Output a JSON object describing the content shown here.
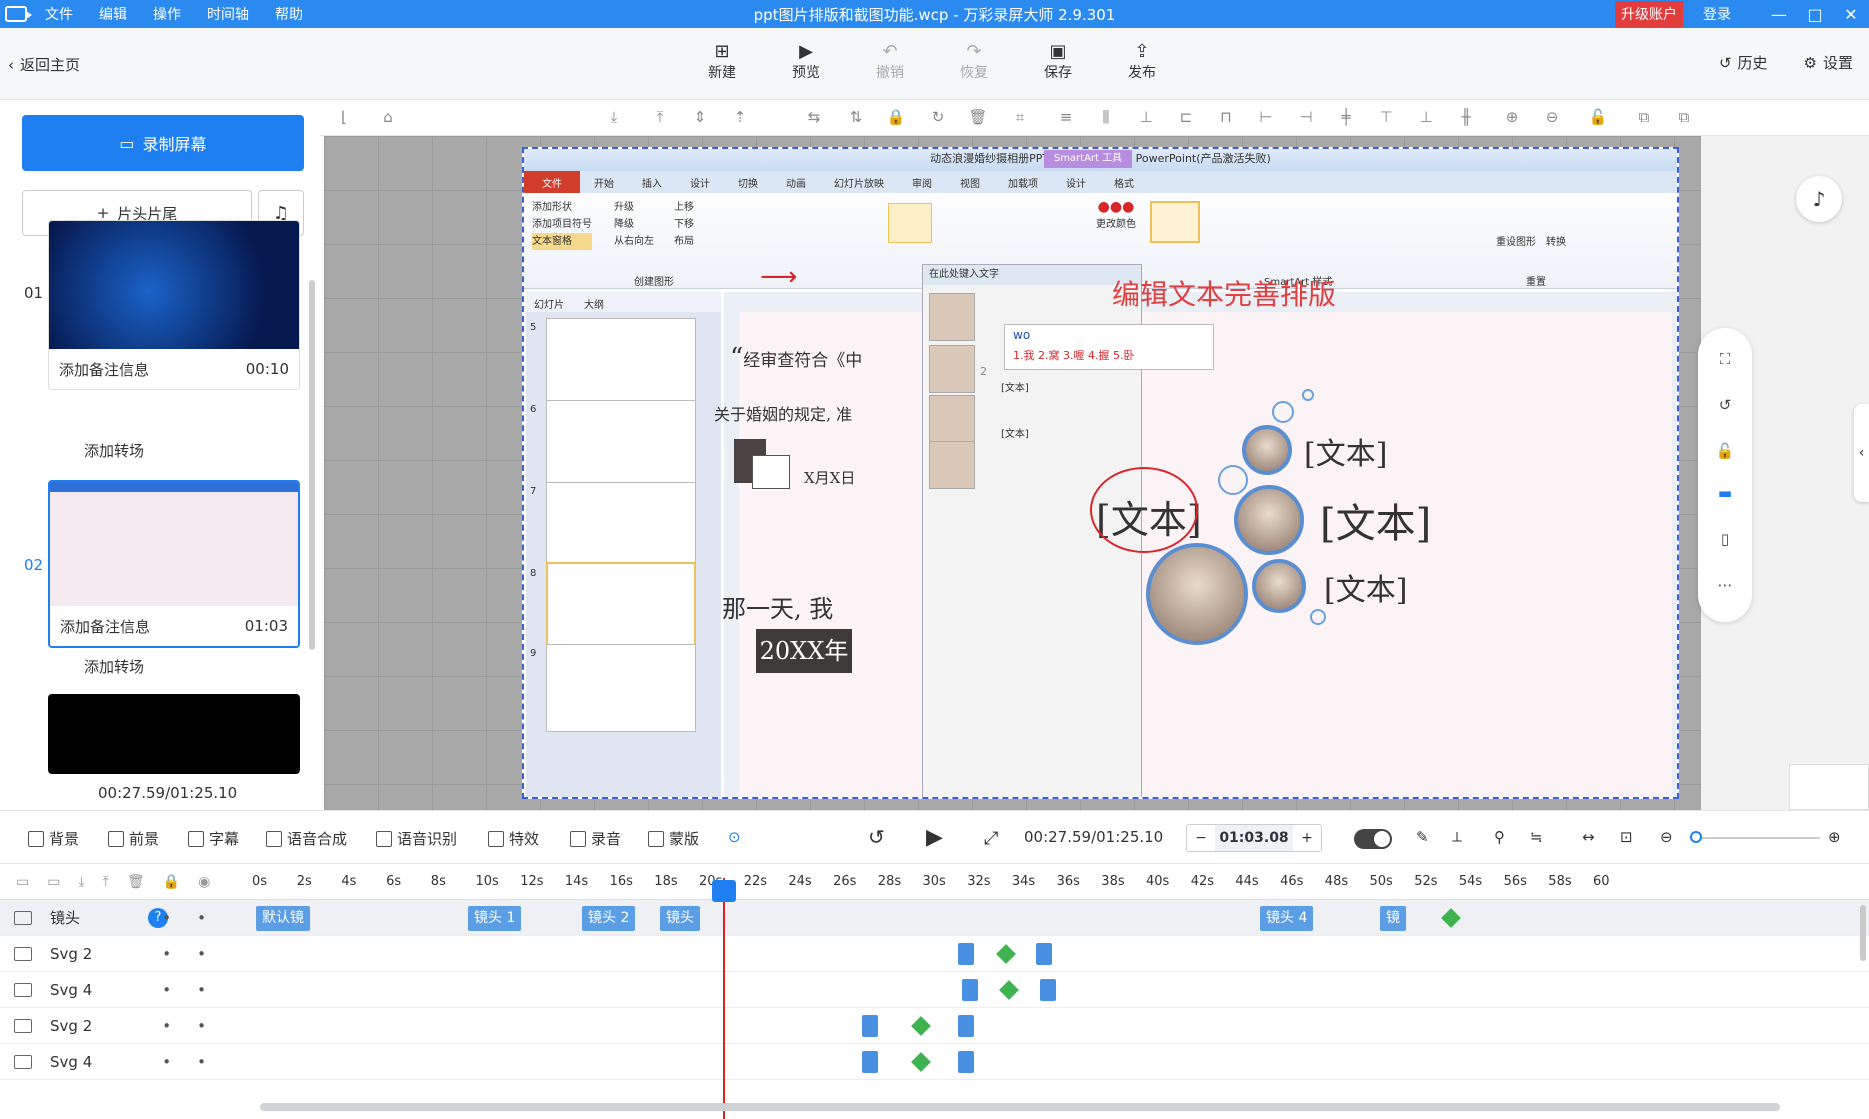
{
  "app": {
    "title": "ppt图片排版和截图功能.wcp - 万彩录屏大师 2.9.301",
    "menu": [
      "文件",
      "编辑",
      "操作",
      "时间轴",
      "帮助"
    ],
    "upgrade": "升级账户",
    "login": "登录",
    "win": [
      "—",
      "□",
      "✕"
    ]
  },
  "toolbar": {
    "back": "返回主页",
    "tools": [
      {
        "label": "新建",
        "icon": "new-icon"
      },
      {
        "label": "预览",
        "icon": "play-icon"
      },
      {
        "label": "撤销",
        "icon": "undo-icon"
      },
      {
        "label": "恢复",
        "icon": "redo-icon"
      },
      {
        "label": "保存",
        "icon": "save-icon"
      },
      {
        "label": "发布",
        "icon": "publish-icon"
      }
    ],
    "history": "历史",
    "settings": "设置"
  },
  "left": {
    "record": "录制屏幕",
    "headtail": "片头片尾",
    "clips": [
      {
        "num": "01",
        "note": "添加备注信息",
        "duration": "00:10"
      },
      {
        "num": "02",
        "note": "添加备注信息",
        "duration": "01:03"
      }
    ],
    "transition": "添加转场",
    "time": "00:27.59/01:25.10"
  },
  "ppt": {
    "window_title": "动态浪漫婚纱摄相册PPT模板 - Microsoft PowerPoint(产品激活失败)",
    "smartart_tools": "SmartArt 工具",
    "tabs": [
      "文件",
      "开始",
      "插入",
      "设计",
      "切换",
      "动画",
      "幻灯片放映",
      "审阅",
      "视图",
      "加载项",
      "设计",
      "格式"
    ],
    "ribbon_left": [
      "添加形状",
      "添加项目符号",
      "文本窗格",
      "升级",
      "降级",
      "从右向左",
      "上移",
      "下移",
      "布局"
    ],
    "group_create": "创建图形",
    "group_style": "SmartArt 样式",
    "group_reset": "重置",
    "change_color": "更改颜色",
    "reset_graphic": "重设图形",
    "convert": "转换",
    "pane_tabs": [
      "幻灯片",
      "大纲"
    ],
    "slide_nums": [
      "5",
      "6",
      "7",
      "8",
      "9"
    ],
    "textpane_title": "在此处键入文字",
    "bullets": [
      "[文本]",
      "[文本]"
    ],
    "ime_input": "wo",
    "ime_candidates": "1.我 2.窝 3.喔 4.握 5.卧",
    "annotation": "编辑文本完善排版",
    "quote": "经审查符合《中",
    "line2": "关于婚姻的规定, 准",
    "date": "X月X日",
    "line3": "那一天, 我",
    "year": "20XX年",
    "text_left": "[文本]",
    "text_r1": "[文本]",
    "text_r2": "[文本]",
    "text_r3": "[文本]",
    "badge": "2"
  },
  "bottom": {
    "items": [
      "背景",
      "前景",
      "字幕",
      "语音合成",
      "语音识别",
      "特效",
      "录音",
      "蒙版"
    ],
    "timecode": "00:27.59/01:25.10",
    "duration": "01:03.08",
    "minus": "−",
    "plus": "+"
  },
  "timeline": {
    "ticks": [
      "0s",
      "2s",
      "4s",
      "6s",
      "8s",
      "10s",
      "12s",
      "14s",
      "16s",
      "18s",
      "20s",
      "22s",
      "24s",
      "26s",
      "28s",
      "30s",
      "32s",
      "34s",
      "36s",
      "38s",
      "40s",
      "42s",
      "44s",
      "46s",
      "48s",
      "50s",
      "52s",
      "54s",
      "56s",
      "58s",
      "60"
    ],
    "lens_track": "镜头",
    "lenses": [
      "默认镜",
      "镜头 1",
      "镜头 2",
      "镜头",
      "镜头 4",
      "镜"
    ],
    "tracks": [
      "Svg 2",
      "Svg 4",
      "Svg 2",
      "Svg 4"
    ]
  },
  "colors": {
    "accent": "#1e7ff0",
    "titlebar": "#2b8af0",
    "upgrade": "#e23c3c",
    "playhead": "#e02020",
    "keyframe": "#3fb34f"
  }
}
